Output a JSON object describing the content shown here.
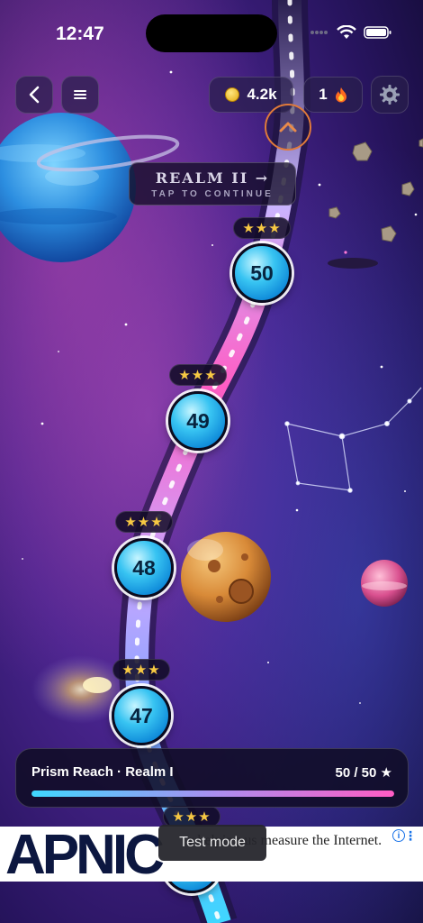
{
  "status_bar": {
    "time": "12:47"
  },
  "top_bar": {
    "back_icon": "chevron-left-icon",
    "menu_icon": "hamburger-icon",
    "coins": "4.2k",
    "coin_icon": "coin-icon",
    "streak": "1",
    "streak_icon": "flame-icon",
    "settings_icon": "gear-icon"
  },
  "realm_banner": {
    "title": "REALM II →",
    "subtitle": "TAP TO CONTINUE"
  },
  "levels": [
    {
      "number": "50",
      "stars": "★★★"
    },
    {
      "number": "49",
      "stars": "★★★"
    },
    {
      "number": "48",
      "stars": "★★★"
    },
    {
      "number": "47",
      "stars": "★★★"
    },
    {
      "number": "",
      "stars": "★★★"
    }
  ],
  "progress": {
    "title": "Prism Reach · Realm I",
    "count": "50 / 50 ★",
    "fraction": 1.0
  },
  "ad": {
    "logo": "APNIC",
    "text": "r helping us measure the Internet."
  },
  "toast": {
    "text": "Test mode"
  },
  "colors": {
    "background": "#2a1660",
    "node": "#2fb8ef",
    "path_pink": "#ff5cc4",
    "path_blue": "#3fd7ff",
    "star": "#f7c843"
  }
}
